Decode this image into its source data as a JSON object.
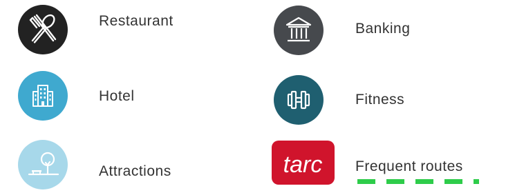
{
  "legend": {
    "items": [
      {
        "key": "restaurant",
        "label": "Restaurant",
        "icon": "fork-spoon-icon",
        "color": "#222222"
      },
      {
        "key": "banking",
        "label": "Banking",
        "icon": "bank-icon",
        "color": "#46494d"
      },
      {
        "key": "hotel",
        "label": "Hotel",
        "icon": "hotel-building-icon",
        "color": "#3fa9cf"
      },
      {
        "key": "fitness",
        "label": "Fitness",
        "icon": "dumbbell-icon",
        "color": "#1f5f70"
      },
      {
        "key": "attractions",
        "label": "Attractions",
        "icon": "tree-bench-icon",
        "color": "#a7d8ea"
      },
      {
        "key": "frequent_routes",
        "label": "Frequent routes",
        "icon": "tarc-logo",
        "color": "#d0142c",
        "logo_text": "tarc",
        "line_color": "#2ecc4a"
      }
    ]
  }
}
